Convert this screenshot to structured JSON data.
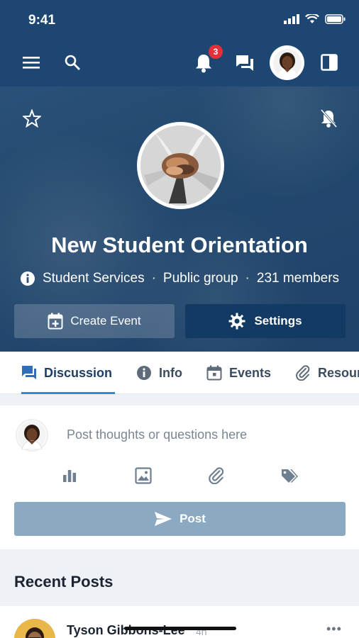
{
  "status_bar": {
    "time": "9:41"
  },
  "nav": {
    "notifications_count": "3",
    "icons": [
      "menu-icon",
      "search-icon",
      "bell-icon",
      "chat-icon",
      "avatar",
      "panel-icon"
    ]
  },
  "group": {
    "title": "New Student Orientation",
    "department": "Student Services",
    "privacy": "Public group",
    "members": "231 members",
    "separator": "·"
  },
  "actions": {
    "create_event": "Create Event",
    "settings": "Settings"
  },
  "tabs": [
    {
      "label": "Discussion",
      "icon": "chat-icon",
      "active": true
    },
    {
      "label": "Info",
      "icon": "info-icon",
      "active": false
    },
    {
      "label": "Events",
      "icon": "calendar-icon",
      "active": false
    },
    {
      "label": "Resour",
      "icon": "paperclip-icon",
      "active": false
    }
  ],
  "composer": {
    "placeholder": "Post thoughts or questions here",
    "post_label": "Post",
    "tools": [
      "poll-icon",
      "image-icon",
      "attachment-icon",
      "tag-icon"
    ]
  },
  "recent": {
    "title": "Recent Posts",
    "first_post": {
      "author": "Tyson Gibbons-Lee",
      "ago": "4h",
      "more": "•••"
    }
  },
  "colors": {
    "header_bg": "#1d4673",
    "settings_btn": "#133a63",
    "tab_underline": "#2f8bd8",
    "post_btn": "#8ca9c2",
    "badge": "#e5303a"
  }
}
